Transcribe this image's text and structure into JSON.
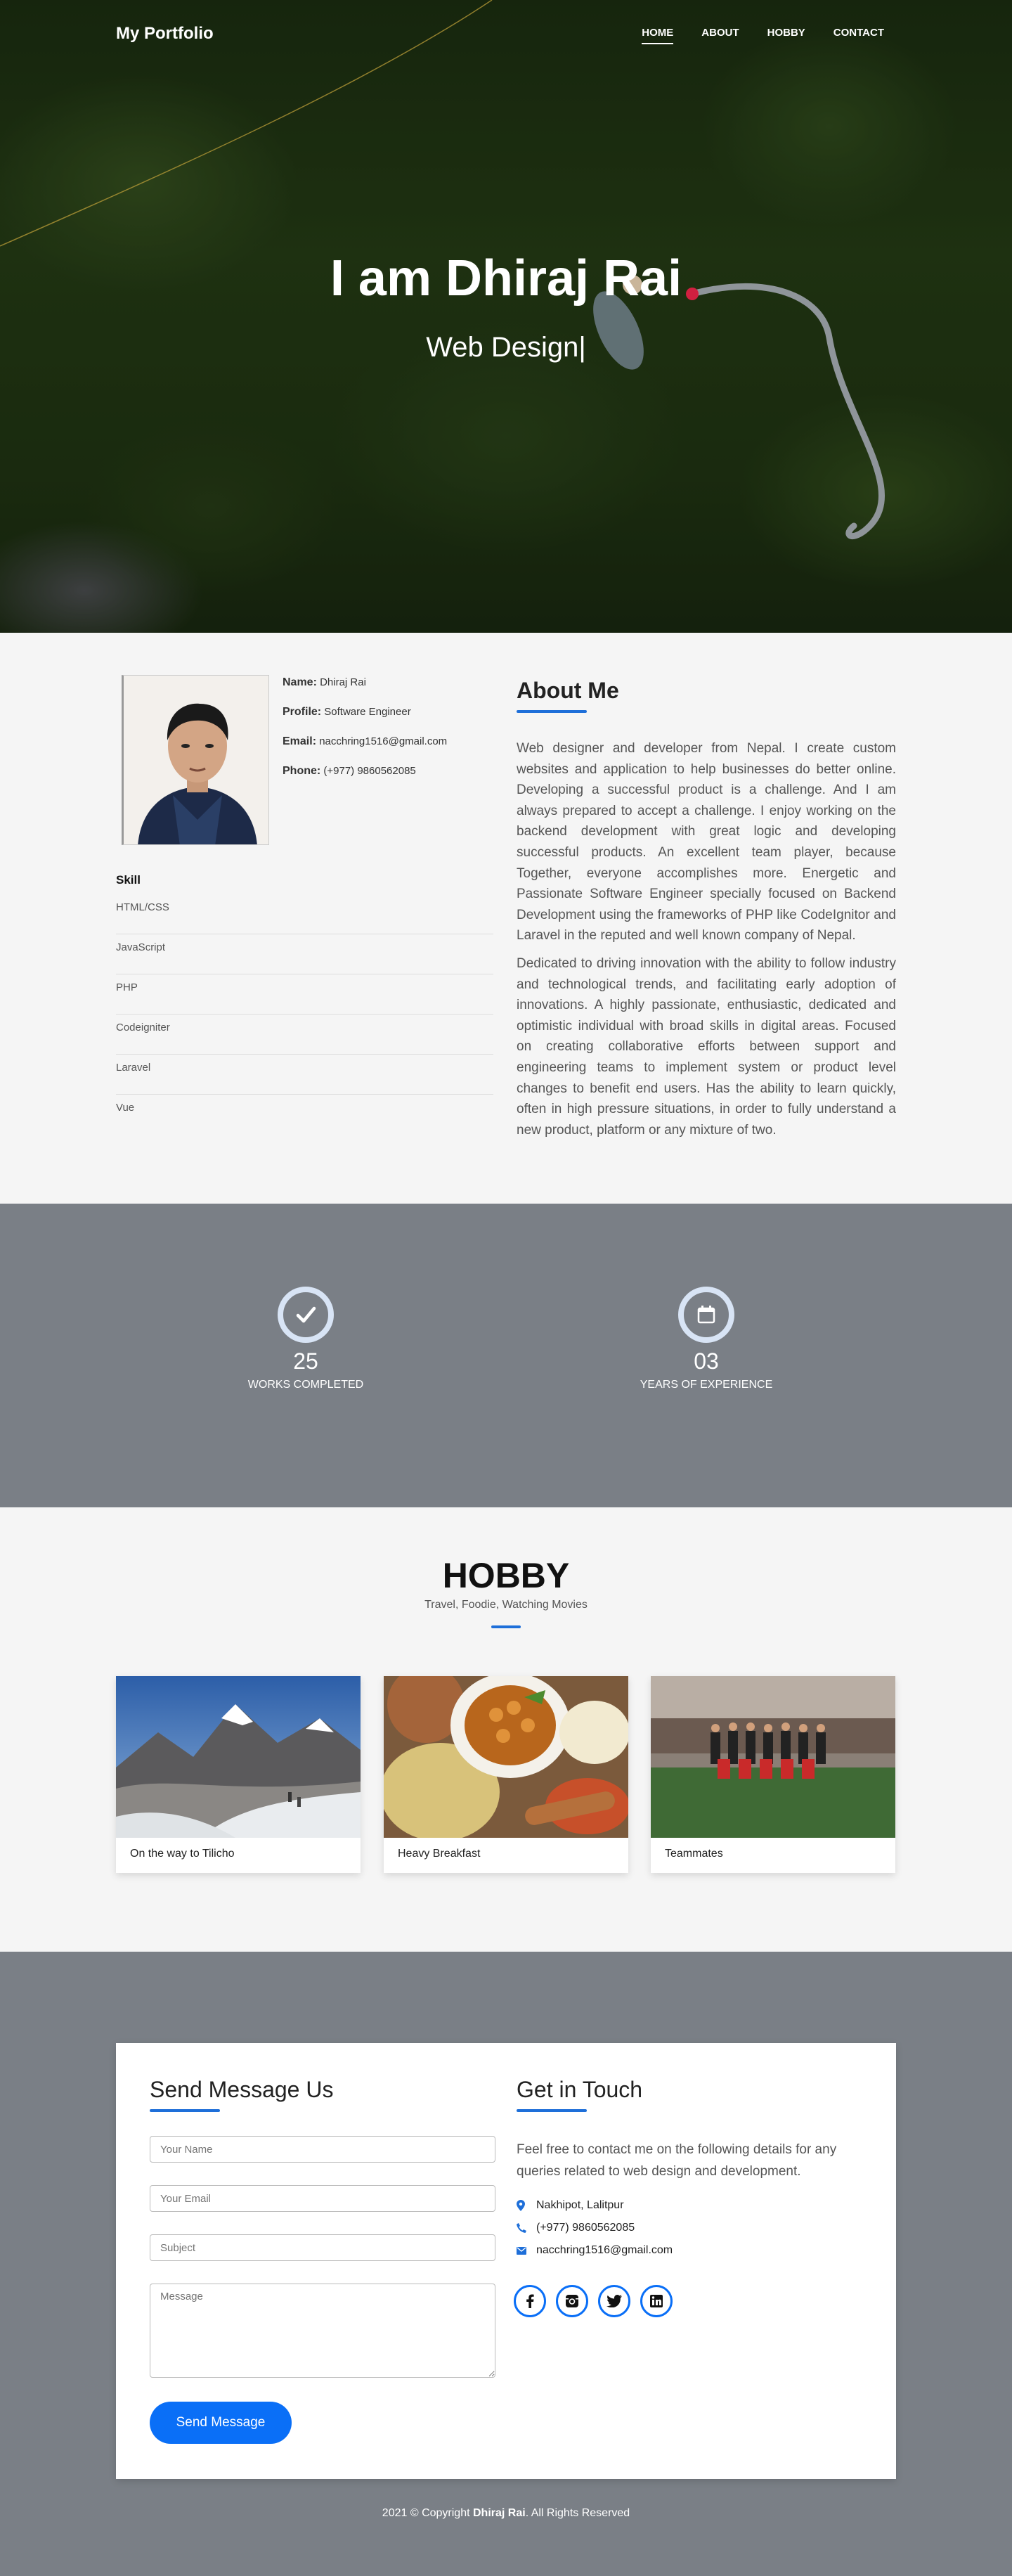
{
  "nav": {
    "brand": "My Portfolio",
    "links": [
      "HOME",
      "ABOUT",
      "HOBBY",
      "CONTACT"
    ]
  },
  "hero": {
    "title": "I am Dhiraj Rai",
    "subtitle": "Web Design|"
  },
  "about": {
    "info": [
      {
        "label": "Name:",
        "value": "Dhiraj Rai"
      },
      {
        "label": "Profile:",
        "value": "Software Engineer"
      },
      {
        "label": "Email:",
        "value": "nacchring1516@gmail.com"
      },
      {
        "label": "Phone:",
        "value": "(+977) 9860562085"
      }
    ],
    "skill_title": "Skill",
    "skills": [
      "HTML/CSS",
      "JavaScript",
      "PHP",
      "Codeigniter",
      "Laravel",
      "Vue"
    ],
    "heading": "About Me",
    "paragraphs": [
      "Web designer and developer from Nepal. I create custom websites and application to help businesses do better online. Developing a successful product is a challenge. And I am always prepared to accept a challenge. I enjoy working on the backend development with great logic and developing successful products. An excellent team player, because Together, everyone accomplishes more. Energetic and Passionate Software Engineer specially focused on Backend Development using the frameworks of PHP like CodeIgnitor and Laravel in the reputed and well known company of Nepal.",
      "Dedicated to driving innovation with the ability to follow industry and technological trends, and facilitating early adoption of innovations. A highly passionate, enthusiastic, dedicated and optimistic individual with broad skills in digital areas. Focused on creating collaborative efforts between support and engineering teams to implement system or product level changes to benefit end users. Has the ability to learn quickly, often in high pressure situations, in order to fully understand a new product, platform or any mixture of two."
    ]
  },
  "stats": [
    {
      "icon": "check-icon",
      "number": "25",
      "label": "WORKS COMPLETED"
    },
    {
      "icon": "calendar-icon",
      "number": "03",
      "label": "YEARS OF EXPERIENCE"
    }
  ],
  "hobby": {
    "title": "HOBBY",
    "subtitle": "Travel, Foodie, Watching Movies",
    "cards": [
      {
        "caption": "On the way to Tilicho"
      },
      {
        "caption": "Heavy Breakfast"
      },
      {
        "caption": "Teammates"
      }
    ]
  },
  "contact": {
    "form_title": "Send Message Us",
    "placeholders": {
      "name": "Your Name",
      "email": "Your Email",
      "subject": "Subject",
      "message": "Message"
    },
    "send_label": "Send Message",
    "touch_title": "Get in Touch",
    "touch_text": "Feel free to contact me on the following details for any queries related to web design and development.",
    "address": "Nakhipot, Lalitpur",
    "phone": "(+977) 9860562085",
    "email": "nacchring1516@gmail.com",
    "social": [
      "facebook-icon",
      "instagram-icon",
      "twitter-icon",
      "linkedin-icon"
    ]
  },
  "footer": {
    "prefix": "2021 © Copyright",
    "name": "Dhiraj Rai",
    "suffix": ". All Rights Reserved"
  },
  "colors": {
    "accent": "#1e6fd9",
    "button": "#0a6ff7",
    "band": "#7a7f86",
    "light_bg": "#f5f5f5"
  }
}
